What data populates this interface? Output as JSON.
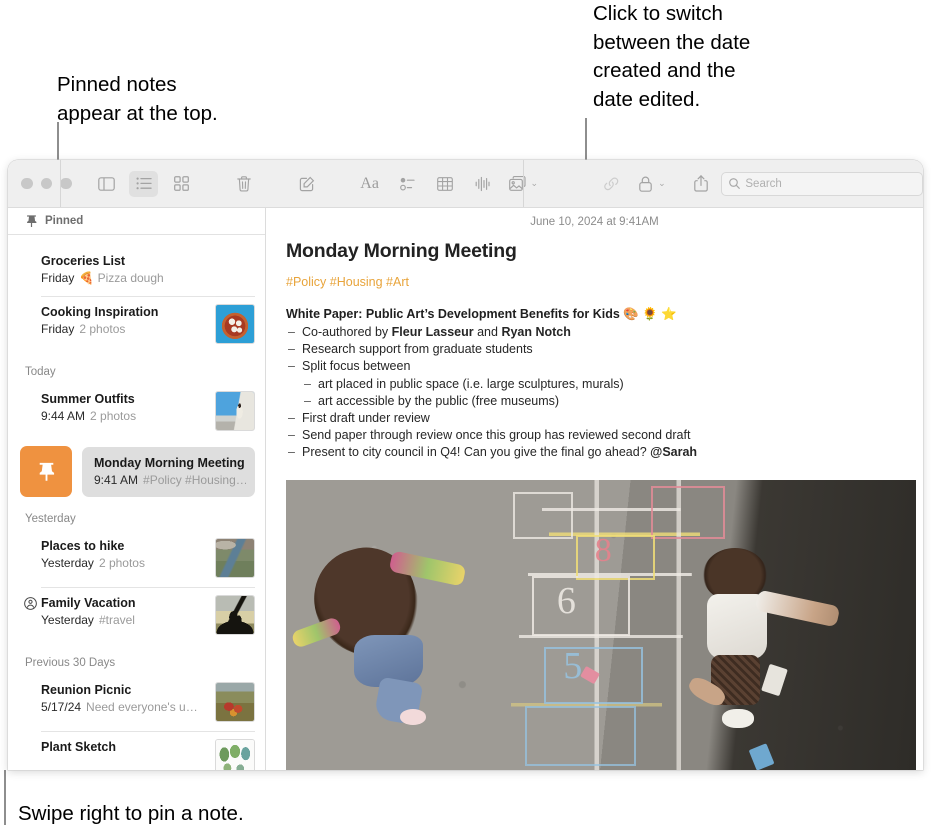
{
  "callouts": {
    "pinned": "Pinned notes\nappear at the top.",
    "date": "Click to switch\nbetween the date\ncreated and the\ndate edited.",
    "swipe": "Swipe right to pin a note."
  },
  "toolbar": {
    "sidebar_toggle": "sidebar-toggle",
    "list_view": "list-view",
    "gallery_view": "gallery-view",
    "delete": "delete",
    "compose": "compose",
    "format": "Aa",
    "checklist": "checklist",
    "table": "table",
    "audio": "audio",
    "media": "media",
    "media_chevron": "⌄",
    "link": "link",
    "lock": "lock",
    "lock_chevron": "⌄",
    "share": "share",
    "search_placeholder": "Search"
  },
  "sidebar": {
    "pinned_header": "Pinned",
    "sections": [
      {
        "title": "",
        "notes": [
          {
            "title": "Groceries List",
            "date": "Friday",
            "preview": "Pizza dough",
            "emoji": "🍕",
            "thumb": "none"
          },
          {
            "title": "Cooking Inspiration",
            "date": "Friday",
            "preview": "2 photos",
            "thumb": "pizza"
          }
        ]
      },
      {
        "title": "Today",
        "notes": [
          {
            "title": "Summer Outfits",
            "date": "9:44 AM",
            "preview": "2 photos",
            "thumb": "beach"
          }
        ]
      },
      {
        "title": "Yesterday",
        "notes": [
          {
            "title": "Places to hike",
            "date": "Yesterday",
            "preview": "2 photos",
            "thumb": "river"
          },
          {
            "title": "Family Vacation",
            "date": "Yesterday",
            "preview": "#travel",
            "thumb": "biker",
            "shared": true
          }
        ]
      },
      {
        "title": "Previous 30 Days",
        "notes": [
          {
            "title": "Reunion Picnic",
            "date": "5/17/24",
            "preview": "Need everyone's u…",
            "thumb": "picnic"
          },
          {
            "title": "Plant Sketch",
            "date": "",
            "preview": "",
            "thumb": "plants"
          }
        ]
      }
    ],
    "selected_note": {
      "title": "Monday Morning Meeting",
      "date": "9:41 AM",
      "preview": "#Policy #Housing…",
      "pin_action": "pin"
    }
  },
  "editor": {
    "date": "June 10, 2024 at 9:41AM",
    "title": "Monday Morning Meeting",
    "tags": "#Policy #Housing #Art",
    "heading": "White Paper: Public Art’s Development Benefits for Kids",
    "heading_emoji": "🎨 🌻 ⭐",
    "bullets": [
      {
        "text_parts": [
          {
            "t": "Co-authored by ",
            "b": false
          },
          {
            "t": "Fleur Lasseur",
            "b": true
          },
          {
            "t": " and ",
            "b": false
          },
          {
            "t": "Ryan Notch",
            "b": true
          }
        ]
      },
      {
        "text_parts": [
          {
            "t": "Research support from graduate students",
            "b": false
          }
        ]
      },
      {
        "text_parts": [
          {
            "t": "Split focus between",
            "b": false
          }
        ],
        "children": [
          {
            "text_parts": [
              {
                "t": "art placed in public space (i.e. large sculptures, murals)",
                "b": false
              }
            ]
          },
          {
            "text_parts": [
              {
                "t": "art accessible by the public (free museums)",
                "b": false
              }
            ]
          }
        ]
      },
      {
        "text_parts": [
          {
            "t": "First draft under review",
            "b": false
          }
        ]
      },
      {
        "text_parts": [
          {
            "t": "Send paper through review once this group has reviewed second draft",
            "b": false
          }
        ]
      },
      {
        "text_parts": [
          {
            "t": "Present to city council in Q4! Can you give the final go ahead? ",
            "b": false
          },
          {
            "t": "@Sarah",
            "b": true
          }
        ]
      }
    ],
    "photo_alt": "Two children playing hopscotch on chalk-marked asphalt"
  },
  "colors": {
    "pin_orange": "#ef9240",
    "tag_amber": "#e8a43b",
    "selected_row": "#dedede",
    "toolbar_bg": "#efefef"
  }
}
